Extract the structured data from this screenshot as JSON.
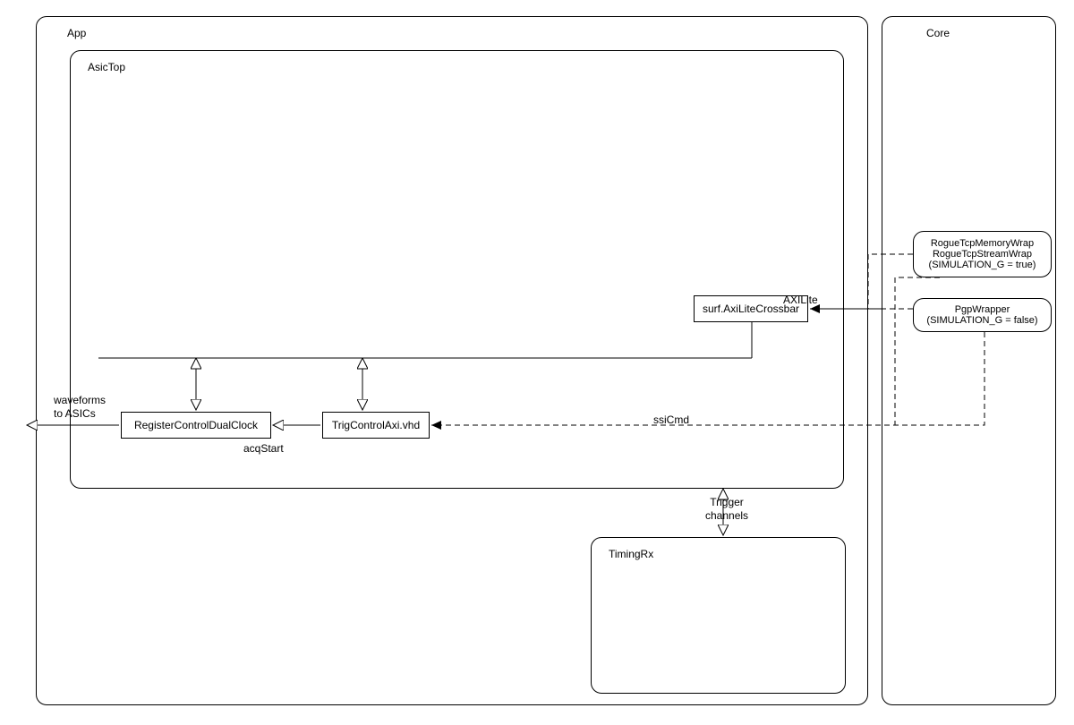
{
  "containers": {
    "app": "App",
    "core": "Core",
    "asic_top": "AsicTop",
    "timing_rx": "TimingRx"
  },
  "blocks": {
    "register_control": "RegisterControlDualClock",
    "trig_control": "TrigControlAxi.vhd",
    "crossbar": "surf.AxiLiteCrossbar",
    "rogue_wrap_line1": "RogueTcpMemoryWrap",
    "rogue_wrap_line2": "RogueTcpStreamWrap",
    "rogue_wrap_line3": "(SIMULATION_G = true)",
    "pgp_wrap_line1": "PgpWrapper",
    "pgp_wrap_line2": "(SIMULATION_G = false)"
  },
  "labels": {
    "waveforms": "waveforms\nto ASICs",
    "acq_start": "acqStart",
    "ssi_cmd": "ssiCmd",
    "axilite": "AXILite",
    "trigger_channels": "Trigger\nchannels"
  },
  "chart_data": {
    "type": "diagram",
    "title": "",
    "nodes": [
      {
        "id": "App",
        "kind": "container"
      },
      {
        "id": "Core",
        "kind": "container"
      },
      {
        "id": "AsicTop",
        "kind": "container",
        "parent": "App"
      },
      {
        "id": "TimingRx",
        "kind": "container",
        "parent": "App"
      },
      {
        "id": "RegisterControlDualClock",
        "kind": "block",
        "parent": "AsicTop"
      },
      {
        "id": "TrigControlAxi.vhd",
        "kind": "block",
        "parent": "AsicTop"
      },
      {
        "id": "surf.AxiLiteCrossbar",
        "kind": "block",
        "parent": "AsicTop"
      },
      {
        "id": "RogueTcpMemoryWrap / RogueTcpStreamWrap (SIMULATION_G = true)",
        "kind": "block",
        "parent": "Core"
      },
      {
        "id": "PgpWrapper (SIMULATION_G = false)",
        "kind": "block",
        "parent": "Core"
      }
    ],
    "edges": [
      {
        "from": "RegisterControlDualClock",
        "to": "ASICs (external)",
        "label": "waveforms to ASICs",
        "style": "solid-open-arrow",
        "direction": "uni"
      },
      {
        "from": "TrigControlAxi.vhd",
        "to": "RegisterControlDualClock",
        "label": "acqStart",
        "style": "solid-open-arrow",
        "direction": "uni"
      },
      {
        "from": "RegisterControlDualClock",
        "to": "bus",
        "label": "",
        "style": "solid-open-double-arrow",
        "direction": "bi"
      },
      {
        "from": "TrigControlAxi.vhd",
        "to": "bus",
        "label": "",
        "style": "solid-open-double-arrow",
        "direction": "bi"
      },
      {
        "from": "surf.AxiLiteCrossbar",
        "to": "bus",
        "label": "",
        "style": "solid",
        "direction": "none"
      },
      {
        "from": "Core",
        "to": "surf.AxiLiteCrossbar",
        "label": "AXILite",
        "style": "solid-filled-arrow",
        "direction": "uni"
      },
      {
        "from": "RogueTcpMemoryWrap",
        "to": "AXILite-line",
        "label": "",
        "style": "dashed",
        "direction": "none"
      },
      {
        "from": "PgpWrapper",
        "to": "AXILite-line",
        "label": "",
        "style": "dashed",
        "direction": "none"
      },
      {
        "from": "PgpWrapper",
        "to": "TrigControlAxi.vhd",
        "label": "ssiCmd",
        "style": "dashed-filled-arrow",
        "direction": "uni"
      },
      {
        "from": "RogueTcpStreamWrap",
        "to": "ssiCmd-line",
        "label": "",
        "style": "dashed",
        "direction": "none"
      },
      {
        "from": "TimingRx",
        "to": "AsicTop",
        "label": "Trigger channels",
        "style": "solid-open-double-arrow",
        "direction": "bi"
      }
    ]
  }
}
